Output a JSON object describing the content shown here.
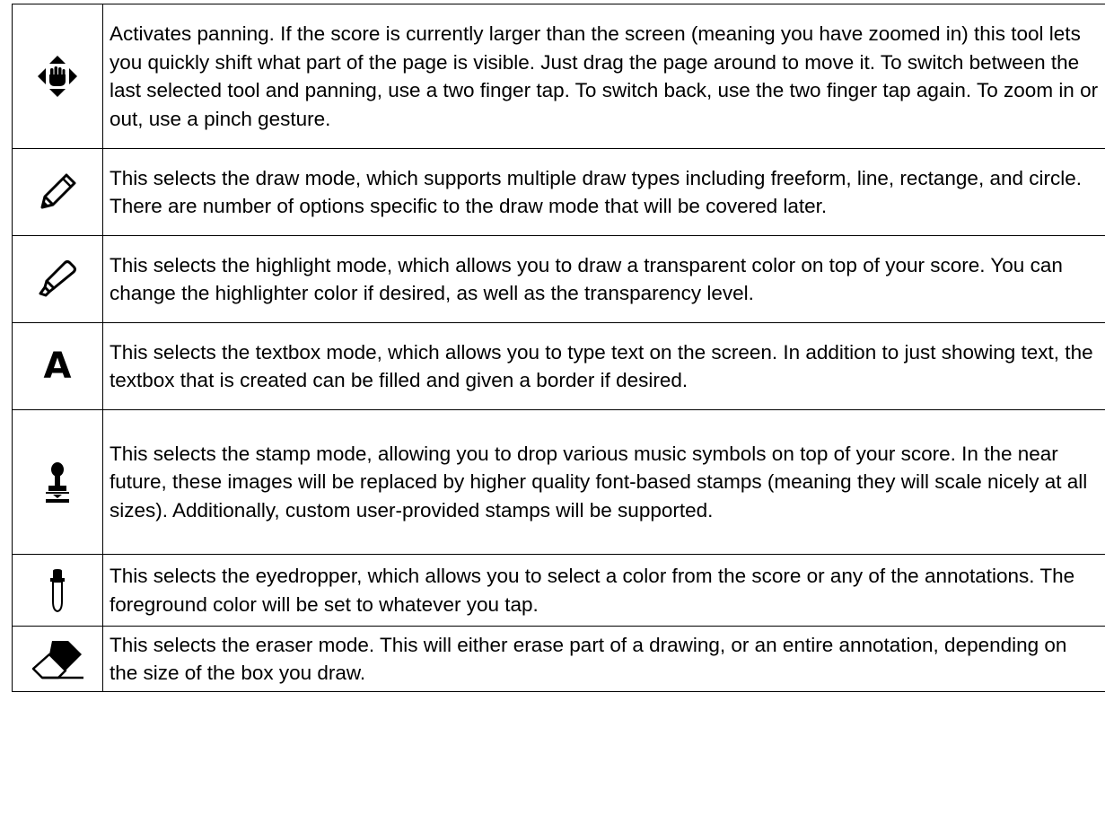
{
  "rows": [
    {
      "icon": "pan-hand-arrows-icon",
      "text": "Activates panning. If the score is currently larger than the screen (meaning you have zoomed in) this tool lets you quickly shift what part of the page is visible. Just drag the page around to move it. To switch between the last selected tool and panning, use a two finger tap. To switch back, use the two finger tap again. To zoom in or out, use a pinch gesture."
    },
    {
      "icon": "pencil-icon",
      "text": "This selects the draw mode, which supports multiple draw types including freeform, line, rectange, and circle. There are number of options specific to the draw mode that will be covered later."
    },
    {
      "icon": "highlighter-icon",
      "text": "This selects the highlight mode, which allows you to draw a transparent color on top of your score. You can change the highlighter color if desired, as well as the transparency level."
    },
    {
      "icon": "text-a-icon",
      "glyph": "A",
      "text": "This selects the textbox mode, which allows you to type text on the screen.  In addition to just showing text, the textbox that is created can be filled and given a border if desired."
    },
    {
      "icon": "stamp-icon",
      "text": "This selects the stamp mode, allowing you to drop various music symbols on top of your score. In the near future, these images will be replaced by higher quality font-based stamps (meaning they will scale nicely at all sizes). Additionally, custom user-provided stamps will be supported."
    },
    {
      "icon": "eyedropper-icon",
      "text": "This selects the eyedropper, which allows you to select a color from the score or any of the annotations. The foreground color will be set to whatever you tap."
    },
    {
      "icon": "eraser-icon",
      "text": "This selects the eraser mode. This will either erase part of a drawing, or an entire annotation, depending on the size of the box you draw."
    }
  ]
}
